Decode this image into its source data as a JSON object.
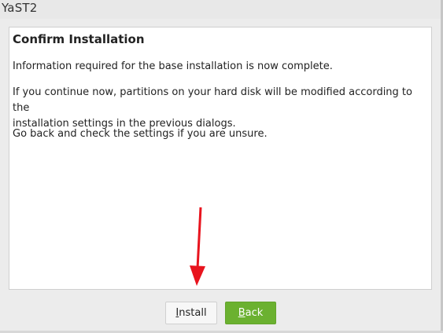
{
  "window": {
    "title": "YaST2"
  },
  "dialog": {
    "heading": "Confirm Installation",
    "paragraph1": "Information required for the base installation is now complete.",
    "paragraph2_line1": "If you continue now, partitions on your hard disk will be modified according to the",
    "paragraph2_line2": "installation settings in the previous dialogs.",
    "paragraph3": "Go back and check the settings if you are unsure."
  },
  "buttons": {
    "install": {
      "mnemonic": "I",
      "rest": "nstall"
    },
    "back": {
      "mnemonic": "B",
      "rest": "ack"
    }
  },
  "colors": {
    "accent_green": "#6bb130",
    "annotation_arrow": "#e8141e"
  },
  "annotation": {
    "icon": "red-arrow-down-icon"
  }
}
